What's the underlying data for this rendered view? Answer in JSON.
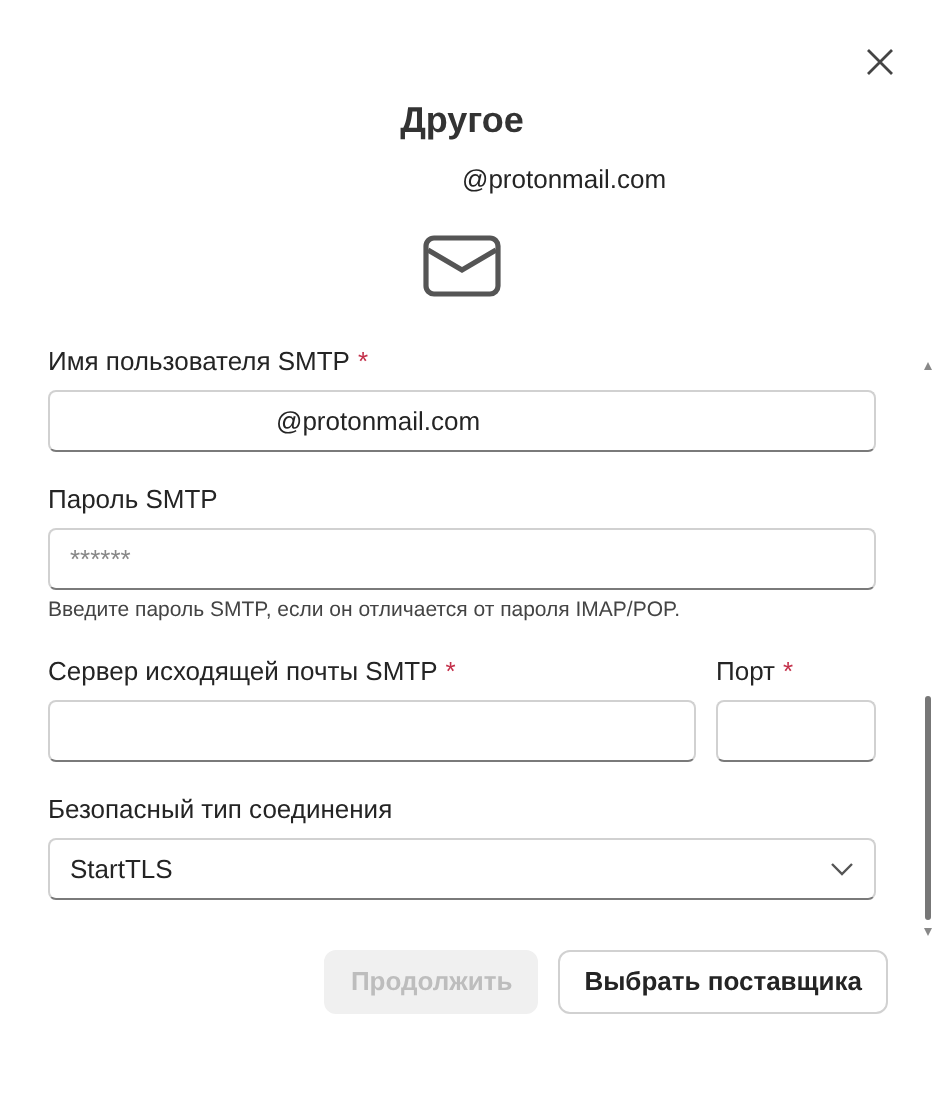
{
  "dialog": {
    "title": "Другое",
    "account": "@protonmail.com"
  },
  "rows": [
    [
      {
        "kind": "text",
        "label": "Имя пользователя SMTP",
        "required_mark": "*",
        "value": "@protonmail.com"
      }
    ],
    [
      {
        "kind": "password",
        "label": "Пароль SMTP",
        "placeholder": "******",
        "help": "Введите пароль SMTP, если он отличается от пароля IMAP/POP."
      }
    ],
    [
      {
        "kind": "text",
        "label": "Сервер исходящей почты SMTP",
        "required_mark": "*"
      },
      {
        "kind": "text",
        "label": "Порт",
        "required_mark": "*"
      }
    ],
    [
      {
        "kind": "select",
        "label": "Безопасный тип соединения",
        "value": "StartTLS"
      }
    ]
  ],
  "buttons": [
    {
      "label": "Продолжить",
      "disabled": true
    },
    {
      "label": "Выбрать поставщика",
      "disabled": false
    }
  ]
}
